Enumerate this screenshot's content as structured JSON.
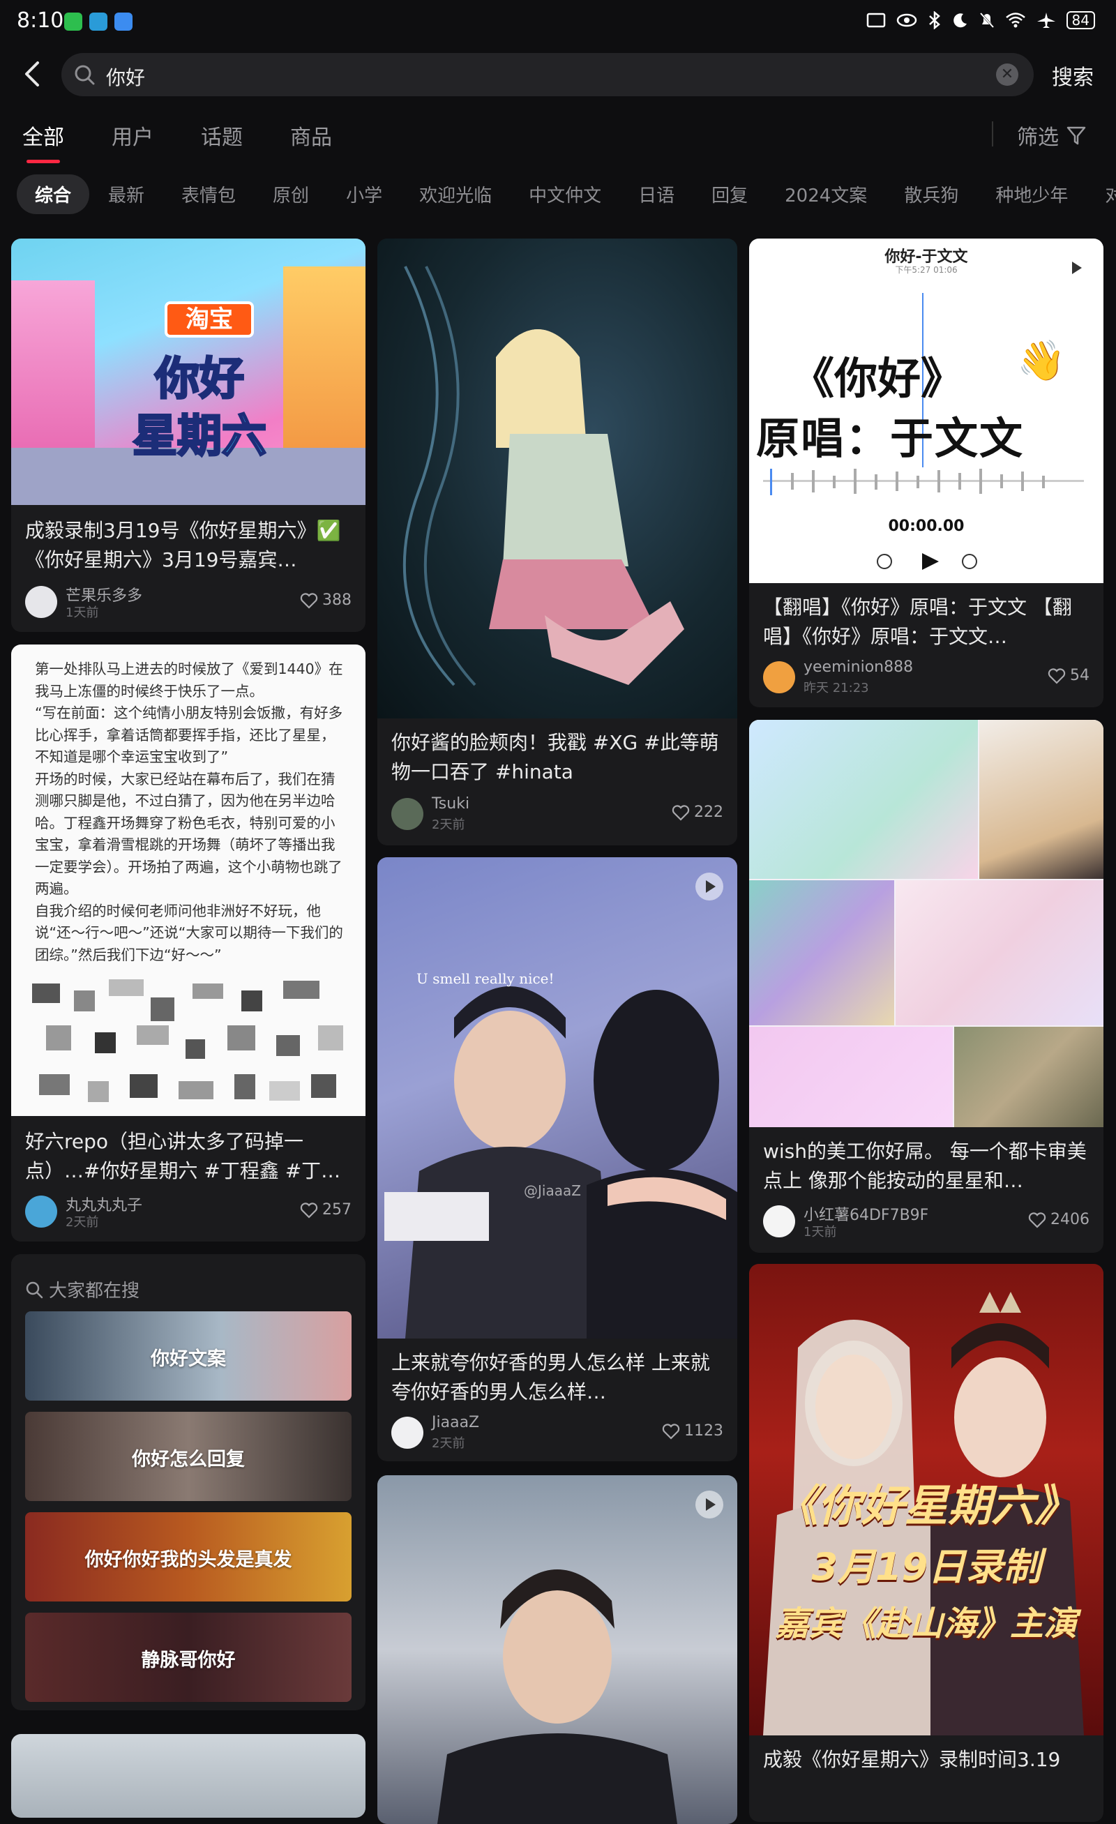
{
  "status": {
    "time": "8:10",
    "battery": "84"
  },
  "search": {
    "query": "你好",
    "submit_label": "搜索"
  },
  "tabs": [
    "全部",
    "用户",
    "话题",
    "商品"
  ],
  "filter_label": "筛选",
  "chips": [
    "综合",
    "最新",
    "表情包",
    "原创",
    "小学",
    "欢迎光临",
    "中文仲文",
    "日语",
    "回复",
    "2024文案",
    "散兵狗",
    "种地少年",
    "对"
  ],
  "cards": {
    "c1": {
      "title": "成毅录制3月19号《你好星期六》✅《你好星期六》3月19号嘉宾…",
      "author": "芒果乐多多",
      "time": "1天前",
      "likes": "388",
      "img_logo": "淘宝",
      "img_title1": "你好",
      "img_title2": "星期六"
    },
    "c2": {
      "text": "第一处排队马上进去的时候放了《爱到1440》在我马上冻僵的时候终于快乐了一点。\n“写在前面：这个纯情小朋友特别会饭撒，有好多比心挥手，拿着话筒都要挥手指，还比了星星，不知道是哪个幸运宝宝收到了”\n开场的时候，大家已经站在幕布后了，我们在猜测哪只脚是他，不过白猜了，因为他在另半边哈哈。丁程鑫开场舞穿了粉色毛衣，特别可爱的小宝宝，拿着滑雪棍跳的开场舞（萌坏了等播出我一定要学会）。开场拍了两遍，这个小萌物也跳了两遍。\n自我介绍的时候何老师问他非洲好不好玩，他说“还～行～吧～”还说“大家可以期待一下我们的团综。”然后我们下边“好～～”",
      "title": "好六repo（担心讲太多了码掉一点）…#你好星期六 #丁程鑫 #丁…",
      "author": "丸丸丸丸子",
      "time": "2天前",
      "likes": "257"
    },
    "c3": {
      "title": "你好酱的脸颊肉！我戳 #XG #此等萌物一口吞了 #hinata",
      "author": "Tsuki",
      "time": "2天前",
      "likes": "222"
    },
    "c4": {
      "title": "上来就夸你好香的男人怎么样 上来就夸你好香的男人怎么样…",
      "author": "JiaaaZ",
      "time": "2天前",
      "likes": "1123",
      "img_caption": "U smell really nice!",
      "img_watermark": "@JiaaaZ"
    },
    "c5": {
      "title": "【翻唱】《你好》原唱：于文文 【翻唱】《你好》原唱：于文文…",
      "author": "yeeminion888",
      "time": "昨天 21:23",
      "likes": "54",
      "img_header": "你好-于文文",
      "img_subheader": "下午5:27 01:06",
      "img_line1": "《你好》",
      "img_line2": "原唱：于文文",
      "img_timer": "00:00.00"
    },
    "c6": {
      "title": "wish的美工你好屌。 每一个都卡审美点上 像那个能按动的星星和…",
      "author": "小红薯64DF7B9F",
      "time": "1天前",
      "likes": "2406"
    },
    "c7": {
      "title": "成毅《你好星期六》录制时间3.19",
      "img_line1": "《你好星期六》",
      "img_line2": "3月19日录制",
      "img_line3": "嘉宾《赴山海》主演"
    }
  },
  "trending": {
    "header": "大家都在搜",
    "items": [
      "你好文案",
      "你好怎么回复",
      "你好你好我的头发是真发",
      "静脉哥你好"
    ]
  },
  "colors": {
    "accent": "#ff2742",
    "background": "#0e0e10",
    "card": "#1b1b1d"
  }
}
